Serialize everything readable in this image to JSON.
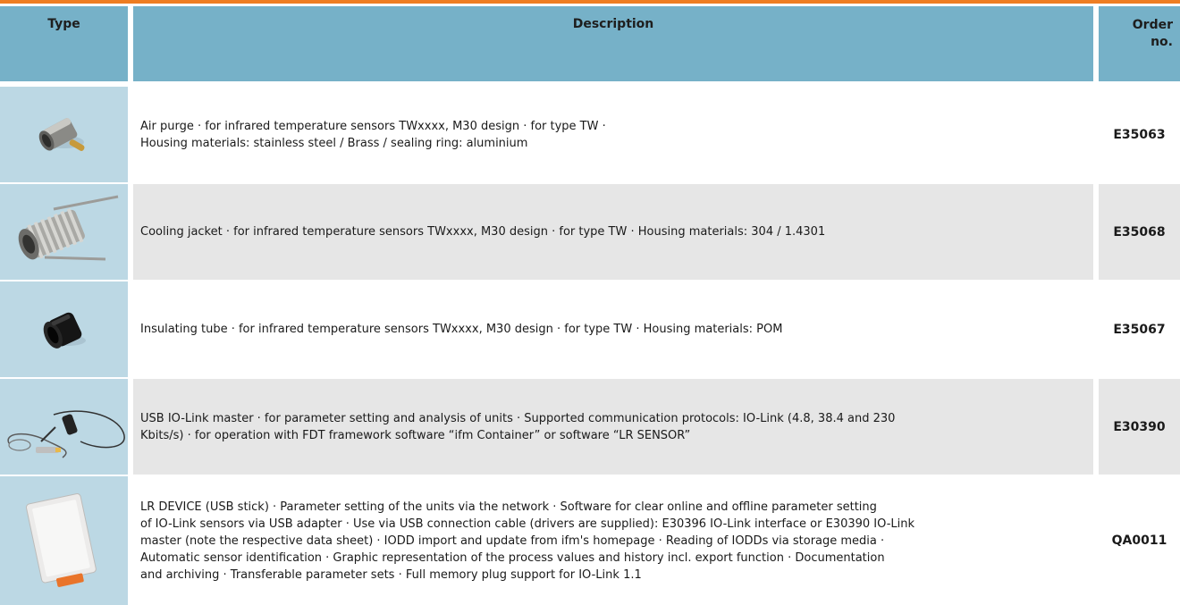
{
  "header": {
    "type_label": "Type",
    "description_label": "Description",
    "order_label_line1": "Order",
    "order_label_line2": "no."
  },
  "rows": [
    {
      "image_icon": "air-purge-image",
      "description_line1": "Air purge · for infrared temperature sensors TWxxxx, M30 design · for type TW ·",
      "description_line2": "Housing materials: stainless steel / Brass / sealing ring: aluminium",
      "order_no": "E35063"
    },
    {
      "image_icon": "cooling-jacket-image",
      "description_line1": "Cooling jacket · for infrared temperature sensors TWxxxx, M30 design · for type TW · Housing materials: 304 / 1.4301",
      "order_no": "E35068"
    },
    {
      "image_icon": "insulating-tube-image",
      "description_line1": "Insulating tube · for infrared temperature sensors TWxxxx, M30 design · for type TW · Housing materials: POM",
      "order_no": "E35067"
    },
    {
      "image_icon": "usb-io-link-master-image",
      "description_line1": "USB IO-Link master · for parameter setting and analysis of units · Supported communication protocols: IO-Link (4.8, 38.4 and 230",
      "description_line2": "Kbits/s) · for operation with FDT framework software “ifm Container” or software “LR SENSOR”",
      "order_no": "E30390"
    },
    {
      "image_icon": "lr-device-usb-stick-image",
      "description_line1": "LR DEVICE (USB stick) · Parameter setting of the units via the network · Software for clear online and offline parameter setting",
      "description_line2": "of IO-Link sensors via USB adapter · Use via USB connection cable (drivers are supplied): E30396 IO-Link interface or E30390 IO-Link",
      "description_line3": "master (note the respective data sheet) · IODD import and update from ifm's homepage · Reading of IODDs via storage media ·",
      "description_line4": "Automatic sensor identification · Graphic representation of the process values and history incl. export function · Documentation",
      "description_line5": "and archiving · Transferable parameter sets · Full memory plug support for IO-Link 1.1",
      "order_no": "QA0011"
    }
  ],
  "colors": {
    "accent_bar": "#ee7d22",
    "header_bg": "#76b1c8",
    "image_cell_bg": "#bcd8e4",
    "row_shade": "#e6e6e6"
  }
}
